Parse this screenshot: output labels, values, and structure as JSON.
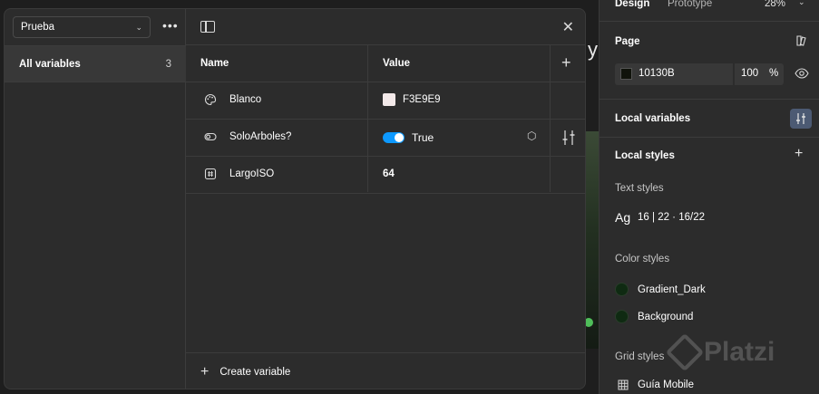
{
  "modal": {
    "collection_name": "Prueba",
    "all_variables_label": "All variables",
    "all_variables_count": "3",
    "columns": {
      "name": "Name",
      "value": "Value"
    },
    "variables": [
      {
        "icon": "palette-icon",
        "name": "Blanco",
        "value": "F3E9E9",
        "swatch_color": "#F3E9E9"
      },
      {
        "icon": "boolean-toggle-icon",
        "name": "SoloArboles?",
        "value": "True"
      },
      {
        "icon": "number-icon",
        "name": "LargoISO",
        "value": "64"
      }
    ],
    "create_variable_label": "Create variable"
  },
  "panel": {
    "tabs": {
      "design": "Design",
      "prototype": "Prototype"
    },
    "zoom": "28%",
    "page": {
      "title": "Page",
      "color_hex": "10130B",
      "color": "#10130B",
      "opacity": "100",
      "opacity_unit": "%"
    },
    "local_variables_label": "Local variables",
    "local_styles_label": "Local styles",
    "text_styles_label": "Text styles",
    "text_style": {
      "sample": "Ag",
      "size": "16",
      "sep": " | ",
      "line_height": "22",
      "detail": " · 16/22"
    },
    "color_styles_label": "Color styles",
    "color_styles": [
      {
        "name": "Gradient_Dark"
      },
      {
        "name": "Background"
      }
    ],
    "grid_styles_label": "Grid styles",
    "grid_style_name": "Guía Mobile"
  },
  "canvas": {
    "peek_letter": "y"
  },
  "watermark": "Platzi",
  "colors": {
    "accent": "#0d99ff",
    "panel_bg": "#2c2c2c",
    "active_button": "#4c5a73"
  }
}
